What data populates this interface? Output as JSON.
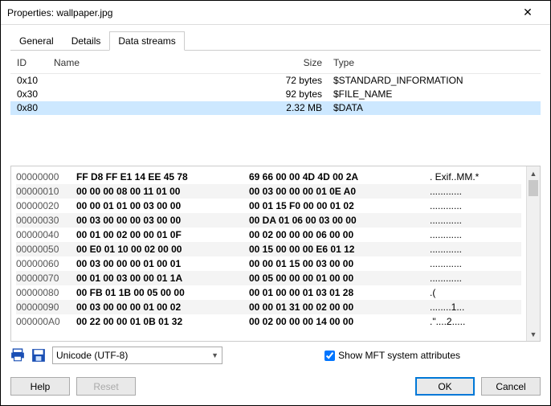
{
  "window": {
    "title": "Properties: wallpaper.jpg"
  },
  "tabs": {
    "general": "General",
    "details": "Details",
    "datastreams": "Data streams"
  },
  "headers": {
    "id": "ID",
    "name": "Name",
    "size": "Size",
    "type": "Type"
  },
  "rows": [
    {
      "id": "0x10",
      "name": "",
      "size": "72 bytes",
      "type": "$STANDARD_INFORMATION"
    },
    {
      "id": "0x30",
      "name": "",
      "size": "92 bytes",
      "type": "$FILE_NAME"
    },
    {
      "id": "0x80",
      "name": "",
      "size": "2.32 MB",
      "type": "$DATA"
    }
  ],
  "hex": [
    {
      "addr": "00000000",
      "b1": "FF D8 FF E1 14 EE 45 78",
      "b2": "69 66 00 00 4D 4D 00 2A",
      "ascii": ". Exif..MM.*"
    },
    {
      "addr": "00000010",
      "b1": "00 00 00 08 00 11 01 00",
      "b2": "00 03 00 00 00 01 0E A0",
      "ascii": "............"
    },
    {
      "addr": "00000020",
      "b1": "00 00 01 01 00 03 00 00",
      "b2": "00 01 15 F0 00 00 01 02",
      "ascii": "............"
    },
    {
      "addr": "00000030",
      "b1": "00 03 00 00 00 03 00 00",
      "b2": "00 DA 01 06 00 03 00 00",
      "ascii": "............"
    },
    {
      "addr": "00000040",
      "b1": "00 01 00 02 00 00 01 0F",
      "b2": "00 02 00 00 00 06 00 00",
      "ascii": "............"
    },
    {
      "addr": "00000050",
      "b1": "00 E0 01 10 00 02 00 00",
      "b2": "00 15 00 00 00 E6 01 12",
      "ascii": "............"
    },
    {
      "addr": "00000060",
      "b1": "00 03 00 00 00 01 00 01",
      "b2": "00 00 01 15 00 03 00 00",
      "ascii": "............"
    },
    {
      "addr": "00000070",
      "b1": "00 01 00 03 00 00 01 1A",
      "b2": "00 05 00 00 00 01 00 00",
      "ascii": "............"
    },
    {
      "addr": "00000080",
      "b1": "00 FB 01 1B 00 05 00 00",
      "b2": "00 01 00 00 01 03 01 28",
      "ascii": ".("
    },
    {
      "addr": "00000090",
      "b1": "00 03 00 00 00 01 00 02",
      "b2": "00 00 01 31 00 02 00 00",
      "ascii": "........1..."
    },
    {
      "addr": "000000A0",
      "b1": "00 22 00 00 01 0B 01 32",
      "b2": "00 02 00 00 00 14 00 00",
      "ascii": ".\"....2....."
    }
  ],
  "encoding": {
    "value": "Unicode (UTF-8)"
  },
  "mft": {
    "label": "Show MFT system attributes"
  },
  "buttons": {
    "help": "Help",
    "reset": "Reset",
    "ok": "OK",
    "cancel": "Cancel"
  }
}
